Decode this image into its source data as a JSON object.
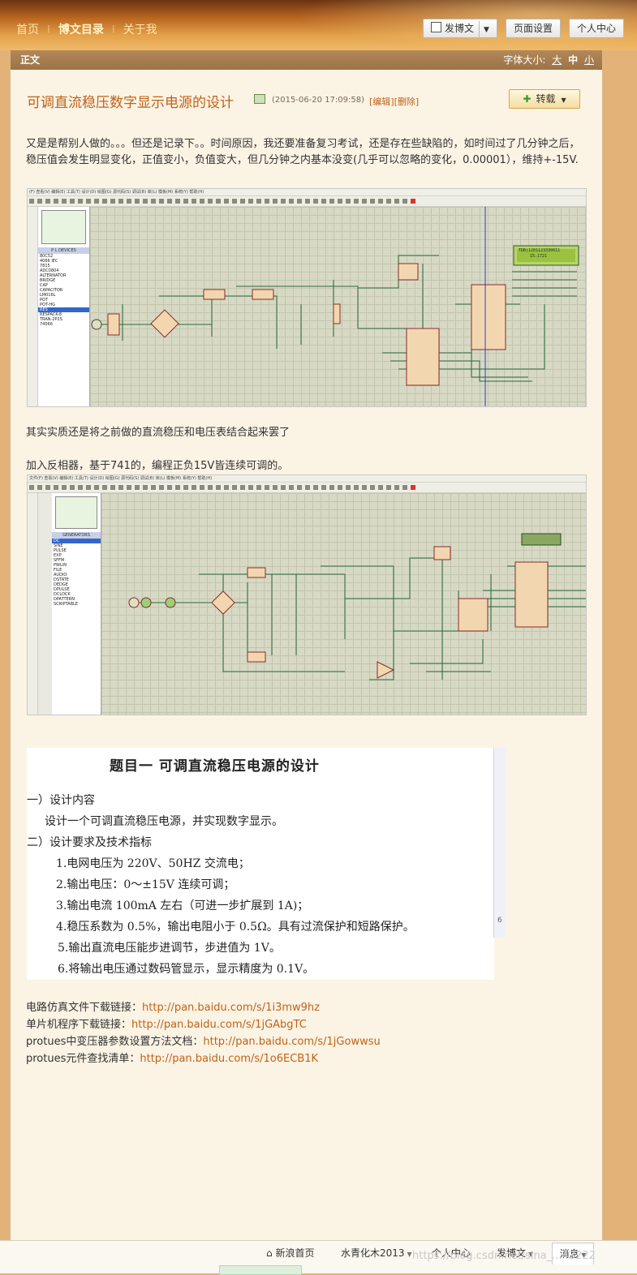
{
  "nav": {
    "home": "首页",
    "catalog": "博文目录",
    "about": "关于我"
  },
  "header_buttons": {
    "post": "发博文",
    "page_settings": "页面设置",
    "personal": "个人中心"
  },
  "panel": {
    "title": "正文",
    "font_size_label": "字体大小:",
    "sizes": [
      "大",
      "中",
      "小"
    ]
  },
  "article": {
    "title": "可调直流稳压数字显示电源的设计",
    "date": "(2015-06-20 17:09:58)",
    "edit": "[编辑]",
    "delete": "[删除]",
    "repost": "转载",
    "p1": "又是是帮别人做的。。。但还是记录下。。时间原因，我还要准备复习考试，还是存在些缺陷的，如时间过了几分钟之后，稳压值会发生明显变化，正值变小，负值变大，但几分钟之内基本没变(几乎可以忽略的变化，0.00001），维持+-15V.",
    "p2": "其实实质还是将之前做的直流稳压和电压表结合起来罢了",
    "p3": "加入反相器，基于741的，编程正负15V皆连续可调的。"
  },
  "shot1": {
    "menu": "(F)  查看(V)  编辑(E)  工具(T)  设计(D)  绘图(G)  源代码(S)  调试(B)  库(L)  模板(M)  系统(Y)  帮助(H)",
    "header": "P  L     DEVICES",
    "items": [
      "80C52",
      "4066 IEC",
      "7815",
      "ADC0804",
      "ALTERNATOR",
      "BRIDGE",
      "CAP",
      "CAPACITOR",
      "LM016L",
      "POT",
      "POT-HG",
      "RES",
      "RESPACK-8",
      "TRAN-2P2S",
      "74066"
    ],
    "selected": "RES",
    "lcd": [
      "TDB(1201123330011",
      "15.1721"
    ]
  },
  "shot2": {
    "menu": "文件(F)  查看(V)  编辑(E)  工具(T)  设计(D)  绘图(G)  源代码(S)  调试(B)  库(L)  模板(M)  系统(Y)  帮助(H)",
    "header": "GENERATORS",
    "items": [
      "DC",
      "SINE",
      "PULSE",
      "EXP",
      "SFFM",
      "PWLIN",
      "FILE",
      "AUDIO",
      "DSTATE",
      "DEDGE",
      "DPULSE",
      "DCLOCK",
      "DPATTERN",
      "SCRIPTABLE"
    ],
    "selected": "DC"
  },
  "task": {
    "title": "题目一    可调直流稳压电源的设计",
    "s1": "一）设计内容",
    "s1a": "设计一个可调直流稳压电源，并实现数字显示。",
    "s2": "二）设计要求及技术指标",
    "items": [
      "1.电网电压为 220V、50HZ 交流电；",
      "2.输出电压：0～±15V 连续可调；",
      "3.输出电流 100mA 左右（可进一步扩展到 1A)；",
      "4.稳压系数为 0.5%，输出电阻小于 0.5Ω。具有过流保护和短路保护。",
      "5.输出直流电压能步进调节，步进值为 1V。",
      "6.将输出电压通过数码管显示，显示精度为 0.1V。"
    ],
    "side_mark": "6"
  },
  "links": [
    {
      "label": "电路仿真文件下载链接：",
      "url": "http://pan.baidu.com/s/1i3mw9hz"
    },
    {
      "label": "单片机程序下载链接：",
      "url": "http://pan.baidu.com/s/1jGAbgTC"
    },
    {
      "label": "protues中变压器参数设置方法文档：",
      "url": "http://pan.baidu.com/s/1jGowwsu"
    },
    {
      "label": "protues元件查找清单：",
      "url": "http://pan.baidu.com/s/1o6ECB1K"
    }
  ],
  "bottom": {
    "home": "新浪首页",
    "user": "水青化木2013",
    "personal": "个人中心",
    "post": "发博文",
    "msg": "消息",
    "watermark": "https://blog.csdn.net/sina_...43222"
  },
  "colors": {
    "link": "#c06217",
    "panel_bg": "#fbf3e4",
    "title_bar": "#a47a4c",
    "schematic_bg": "#d7d9c4"
  }
}
